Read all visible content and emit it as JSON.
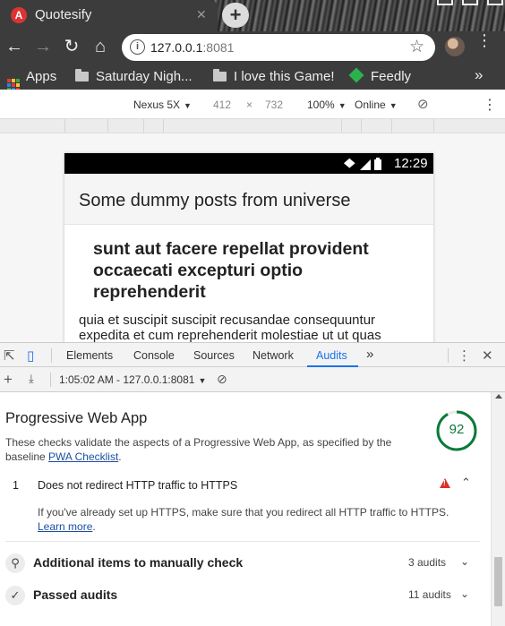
{
  "browser": {
    "tab_title": "Quotesify",
    "tab_close": "✕",
    "new_tab": "+",
    "url_host": "127.0.0.1",
    "url_port": ":8081",
    "bookmarks": [
      {
        "label": "Apps"
      },
      {
        "label": "Saturday Nigh..."
      },
      {
        "label": "I love this Game!"
      },
      {
        "label": "Feedly"
      }
    ]
  },
  "device_toolbar": {
    "device": "Nexus 5X",
    "width": "412",
    "times": "×",
    "height": "732",
    "zoom": "100%",
    "network": "Online"
  },
  "app": {
    "status_time": "12:29",
    "header_title": "Some dummy posts from universe",
    "post_title": "sunt aut facere repellat provident occaecati excepturi optio reprehenderit",
    "post_body": "quia et suscipit suscipit recusandae consequuntur expedita et cum reprehenderit molestiae ut ut quas"
  },
  "devtools": {
    "tabs": [
      "Elements",
      "Console",
      "Sources",
      "Network",
      "Audits"
    ],
    "active_tab": "Audits",
    "more": "»",
    "report_select": "1:05:02 AM - 127.0.0.1:8081"
  },
  "audits": {
    "category_title": "Progressive Web App",
    "description_prefix": "These checks validate the aspects of a Progressive Web App, as specified by the baseline ",
    "checklist_link": "PWA Checklist",
    "description_suffix": ".",
    "score": "92",
    "score_fraction": 0.92,
    "score_color": "#0b7a3a",
    "failed_audit": {
      "number": "1",
      "title": "Does not redirect HTTP traffic to HTTPS",
      "help": "If you've already set up HTTPS, make sure that you redirect all HTTP traffic to HTTPS. ",
      "learn_more": "Learn more",
      "help_suffix": "."
    },
    "groups": [
      {
        "title": "Additional items to manually check",
        "count": "3 audits",
        "icon": "magnifier-icon"
      },
      {
        "title": "Passed audits",
        "count": "11 audits",
        "icon": "checkmark-icon"
      }
    ]
  }
}
